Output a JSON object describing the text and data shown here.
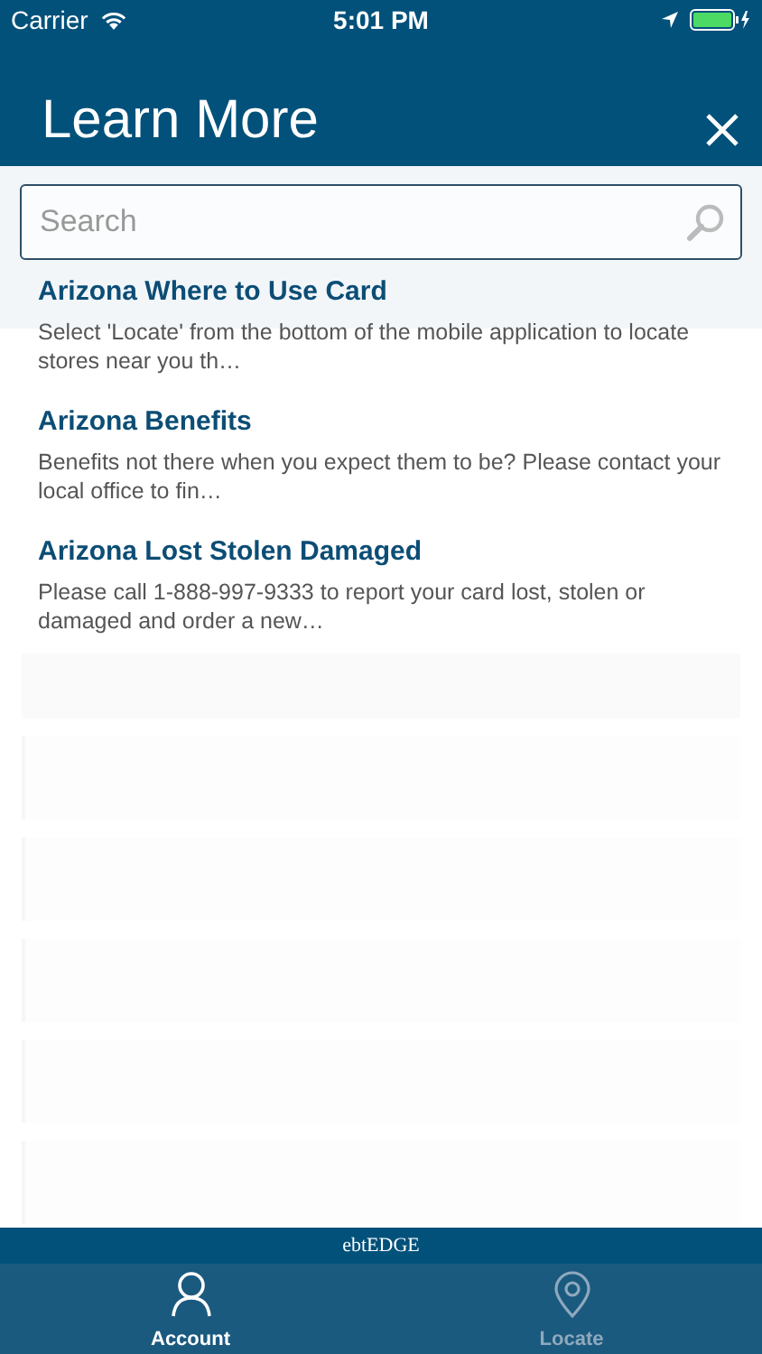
{
  "status_bar": {
    "carrier": "Carrier",
    "time": "5:01 PM"
  },
  "header": {
    "title": "Learn More"
  },
  "search": {
    "placeholder": "Search"
  },
  "articles": [
    {
      "title": "Arizona Where to Use Card",
      "summary": "Select 'Locate' from the bottom of the mobile application to locate stores near you th…"
    },
    {
      "title": "Arizona Benefits",
      "summary": "Benefits not there when you expect them to be? Please contact your local office to fin…"
    },
    {
      "title": "Arizona Lost Stolen Damaged",
      "summary": "Please call 1-888-997-9333 to report your card lost, stolen or damaged and order a new…"
    }
  ],
  "brand": "ebtEDGE",
  "tabs": [
    {
      "label": "Account",
      "kind": "person",
      "selected": true
    },
    {
      "label": "Locate",
      "kind": "pin",
      "selected": false
    }
  ]
}
